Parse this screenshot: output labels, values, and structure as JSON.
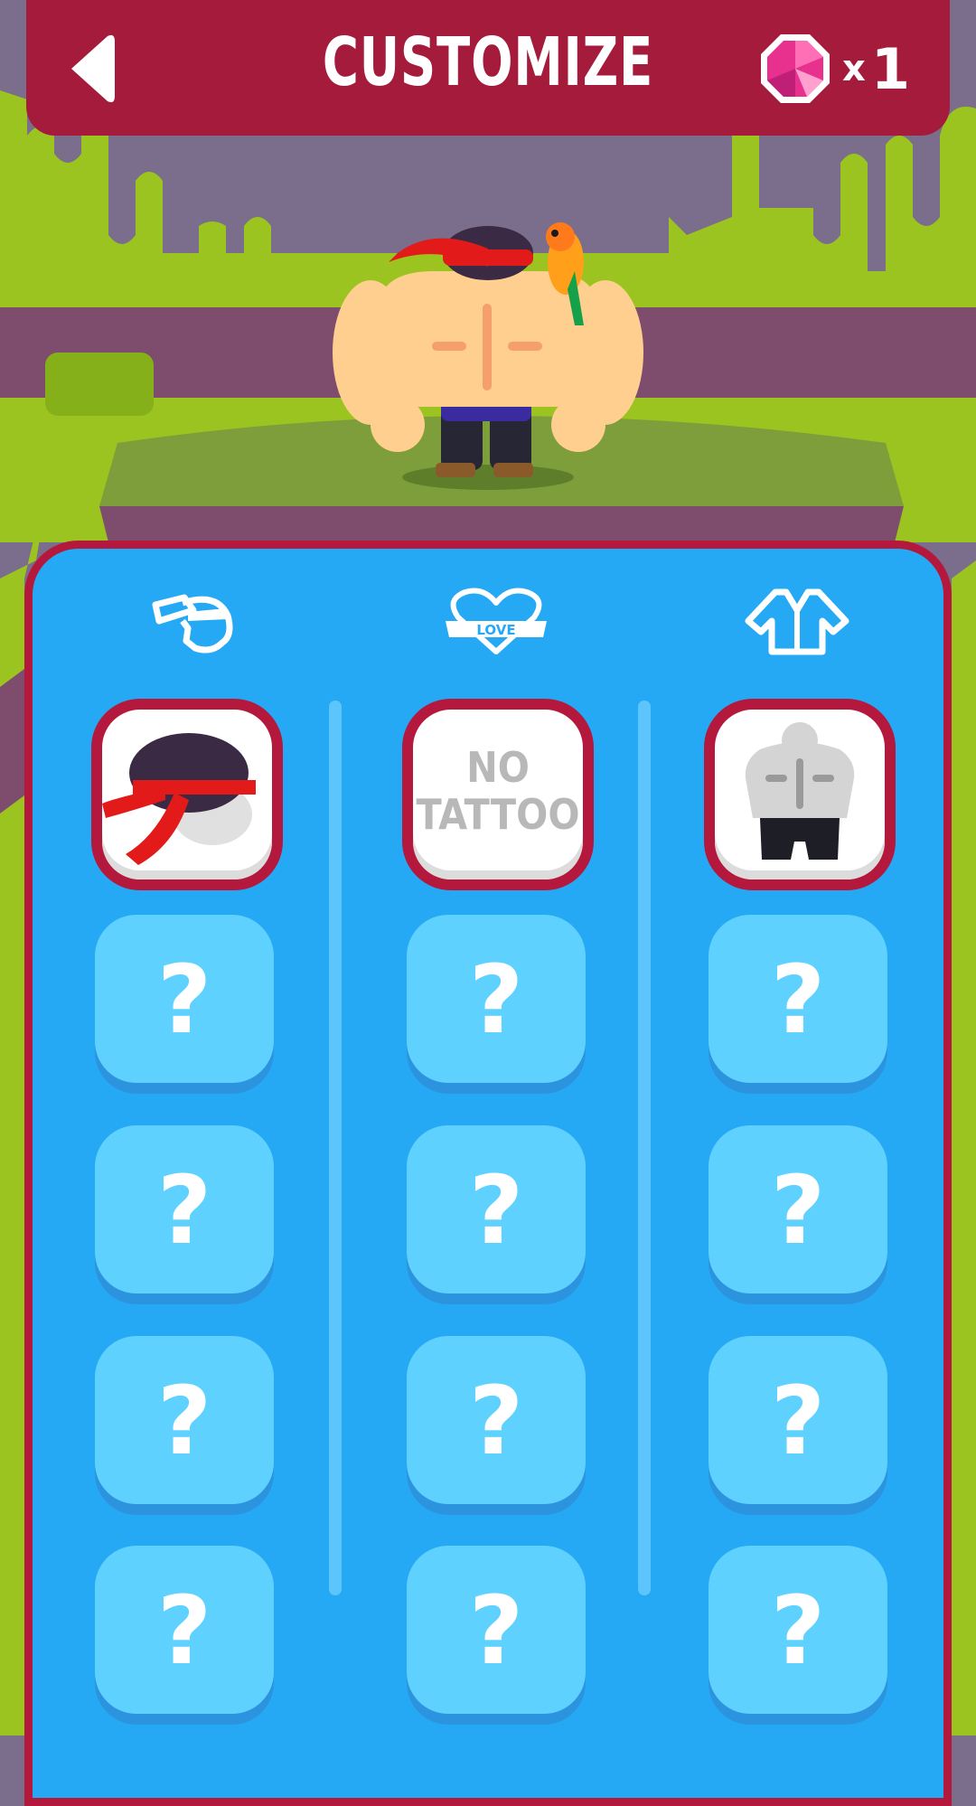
{
  "header": {
    "title": "CUSTOMIZE",
    "back_icon": "back-arrow-icon",
    "gem": {
      "icon": "pink-gem-icon",
      "multiplier": "x",
      "count": "1"
    }
  },
  "categories": [
    {
      "id": "headwear",
      "icon": "bandana-head-icon"
    },
    {
      "id": "tattoo",
      "icon": "love-heart-tattoo-icon",
      "icon_text": "LOVE"
    },
    {
      "id": "outfit",
      "icon": "shirt-icon"
    }
  ],
  "columns": [
    {
      "selected": {
        "icon": "red-headband-hair-icon"
      },
      "locked": [
        "?",
        "?",
        "?",
        "?"
      ]
    },
    {
      "selected": {
        "label": "NO\nTATTOO"
      },
      "locked": [
        "?",
        "?",
        "?",
        "?"
      ]
    },
    {
      "selected": {
        "icon": "body-outfit-icon"
      },
      "locked": [
        "?",
        "?",
        "?",
        "?"
      ]
    }
  ],
  "colors": {
    "header_bg": "#a51b3c",
    "panel_bg": "#26a9f5",
    "slot_bg": "#5fd1ff",
    "selected_border": "#b5183d",
    "grass": "#9cc420",
    "sky": "#7a6e8c"
  }
}
